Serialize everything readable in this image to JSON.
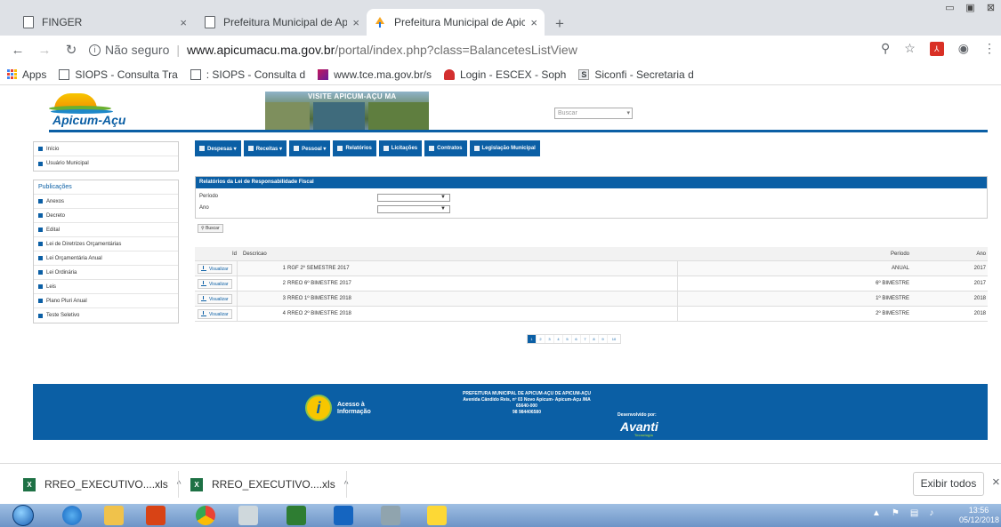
{
  "browser": {
    "tabs": [
      {
        "title": "FINGER"
      },
      {
        "title": "Prefeitura Municipal de Apicuma"
      },
      {
        "title": "Prefeitura Municipal de Apicuma"
      }
    ],
    "new_tab": "+",
    "close_glyph": "×",
    "security_label": "Não seguro",
    "url_host": "www.apicumacu.ma.gov.br",
    "url_path": "/portal/index.php?class=BalancetesListView",
    "bookmarks": [
      {
        "label": "Apps"
      },
      {
        "label": "SIOPS - Consulta Tra"
      },
      {
        "label": ": SIOPS - Consulta d"
      },
      {
        "label": "www.tce.ma.gov.br/s"
      },
      {
        "label": "Login - ESCEX - Soph"
      },
      {
        "label": "Siconfi - Secretaria d"
      }
    ]
  },
  "site": {
    "logo_text": "Apicum-Açu",
    "banner_title": "VISITE APICUM-AÇU MA",
    "search_placeholder": "Buscar",
    "sidebar": {
      "top": [
        {
          "label": "Início"
        },
        {
          "label": "Usuário Municipal"
        }
      ],
      "publications_title": "Publicações",
      "publications": [
        {
          "label": "Anexos"
        },
        {
          "label": "Decreto"
        },
        {
          "label": "Edital"
        },
        {
          "label": "Lei de Diretrizes Orçamentárias"
        },
        {
          "label": "Lei Orçamentária Anual"
        },
        {
          "label": "Lei Ordinária"
        },
        {
          "label": "Leis"
        },
        {
          "label": "Plano Pluri Anual"
        },
        {
          "label": "Teste Seletivo"
        }
      ]
    },
    "menu": [
      {
        "label": "Despesas ▾"
      },
      {
        "label": "Receitas ▾"
      },
      {
        "label": "Pessoal ▾"
      },
      {
        "label": "Relatórios"
      },
      {
        "label": "Licitações"
      },
      {
        "label": "Contratos"
      },
      {
        "label": "Legislação Municipal"
      }
    ],
    "panel": {
      "title": "Relatórios da Lei de Responsabilidade Fiscal",
      "periodo_label": "Período",
      "ano_label": "Ano",
      "search_button": "Buscar"
    },
    "table": {
      "headers": {
        "id": "Id",
        "descricao": "Descricao",
        "periodo": "Período",
        "ano": "Ano"
      },
      "view_label": "Visualizar",
      "rows": [
        {
          "id": "1",
          "descricao": "RGF 2º SEMESTRE 2017",
          "periodo": "ANUAL",
          "ano": "2017"
        },
        {
          "id": "2",
          "descricao": "RREO 6º BIMESTRE 2017",
          "periodo": "6º BIMESTRE",
          "ano": "2017"
        },
        {
          "id": "3",
          "descricao": "RREO 1º BIMESTRE 2018",
          "periodo": "1º BIMESTRE",
          "ano": "2018"
        },
        {
          "id": "4",
          "descricao": "RREO 2º BIMESTRE 2018",
          "periodo": "2º BIMESTRE",
          "ano": "2018"
        }
      ]
    },
    "pagination": [
      "1",
      "2",
      "3",
      "4",
      "5",
      "6",
      "7",
      "8",
      "9",
      "10"
    ],
    "footer": {
      "access_label": "Acesso à Informação",
      "address_lines": [
        "PREFEITURA MUNICIPAL DE APICUM-AÇU DE APICUM-AÇU",
        "Avenida Cândido Reis, nº 03 Novo Apicum- Apicum-Açu /MA",
        "65640-000",
        "98 984406580"
      ],
      "developed_by": "Desenvolvido por:",
      "developer": "Avanti",
      "developer_sub": "Tecnologia"
    }
  },
  "downloads": {
    "items": [
      {
        "name": "RREO_EXECUTIVO....xls"
      },
      {
        "name": "RREO_EXECUTIVO....xls"
      }
    ],
    "show_all": "Exibir todos"
  },
  "taskbar": {
    "time": "13:56",
    "date": "05/12/2018"
  }
}
